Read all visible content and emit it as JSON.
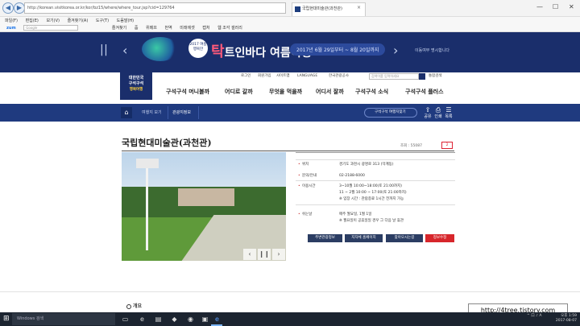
{
  "browser": {
    "url": "http://korean.visitkorea.or.kr/kor/bz15/where/where_tour.jsp?cid=129764",
    "tab_title": "국립현대미술관(과천관)",
    "tab_close": "×",
    "back": "◀",
    "forward": "▶",
    "controls": {
      "minimize": "—",
      "maximize": "☐",
      "close": "✕"
    },
    "menu": [
      "파일(F)",
      "편집(E)",
      "보기(V)",
      "즐겨찾기(A)",
      "도구(T)",
      "도움말(H)"
    ],
    "favbar": {
      "zum": "zum",
      "search_placeholder": "Google",
      "items": [
        "즐겨찾기",
        "줌",
        "위메프",
        "번역",
        "미래에셋",
        "캡처",
        "웹 조각 갤러리"
      ]
    }
  },
  "banner": {
    "prev": "‹",
    "next": "›",
    "pause": "| |",
    "badge": "2017 여름 행복한",
    "title_big": "탁",
    "title_rest": "트인바다 여름여행",
    "date": "2017년 6월 29일부터 ~ 8월 20일까지",
    "link": "이동여부 명시합니다"
  },
  "util": {
    "items": [
      "로그인",
      "회원가입",
      "사이트맵",
      "LANGUAGE",
      "한국관광공사",
      "한국관광공사추천",
      "통합검색"
    ],
    "search_placeholder": "검색어를 입력하세요"
  },
  "logo": {
    "line1": "대한민국",
    "line2": "구석구석",
    "line3": "행복여행"
  },
  "nav": [
    "구석구석 머니볼까",
    "어디로 갈까",
    "무엇을 먹을까",
    "어디서 잘까",
    "구석구석 소식",
    "구석구석 플러스"
  ],
  "breadcrumb": {
    "home": "⌂",
    "items": [
      "여행지 보기",
      "관광지정보"
    ],
    "trip_button": "구석구석 여행지찾기",
    "tools": [
      {
        "glyph": "⇪",
        "label": "공유"
      },
      {
        "glyph": "⎙",
        "label": "인쇄"
      },
      {
        "glyph": "☰",
        "label": "목록"
      }
    ]
  },
  "content": {
    "title": "국립현대미술관(과천관)",
    "views": "조회 : 55087",
    "likes": "2",
    "info": [
      {
        "key": "위치",
        "value": "경기도 과천시 광명로 313 (막계동)"
      },
      {
        "key": "문의/안내",
        "value": "02-2188-6000"
      },
      {
        "key": "이용시간",
        "value": "3~10월 10:00~18:00(토 21:00까지)",
        "value2": "11 ~ 2월 10:00 ~ 17:00(토 21:00까지)",
        "value3": "※ 입장 시간 : 관람종료 1시간 전까지 가능"
      },
      {
        "key": "쉬는날",
        "value": "매주 월요일, 1월 1일",
        "value2": "※ 월요일이 공휴일일 경우 그 다음 날 휴관"
      }
    ],
    "actions": [
      "주변관광정보",
      "지자체 홈페이지",
      "찾아오시는길",
      "정보수정"
    ],
    "photo_prev": "‹",
    "photo_pause": "❙❙",
    "photo_next": "›",
    "overview_label": "개요"
  },
  "taskbar": {
    "search_placeholder": "Windows 검색",
    "tray": "^ 口 ♪ A",
    "time": "오후 1:59",
    "date": "2017-08-07"
  },
  "watermark": "http://4tree.tistory.com"
}
